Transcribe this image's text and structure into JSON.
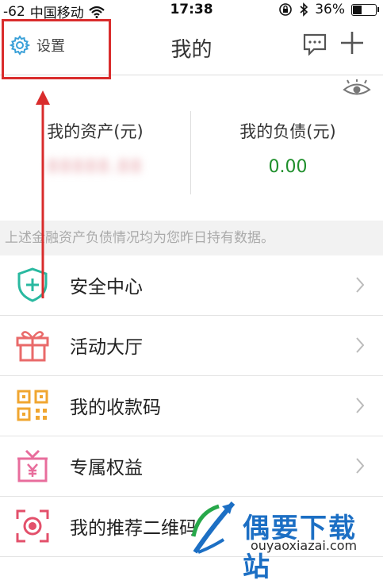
{
  "status_bar": {
    "signal": "-62",
    "carrier": "中国移动",
    "time": "17:38",
    "battery": "36%",
    "battery_level": 0.36
  },
  "nav": {
    "settings_label": "设置",
    "title": "我的"
  },
  "assets": {
    "left_label": "我的资产(元)",
    "left_value": "88888.88",
    "right_label": "我的负债(元)",
    "right_value": "0.00"
  },
  "notice": "上述金融资产负债情况均为您昨日持有数据。",
  "menu": {
    "items": [
      {
        "label": "安全中心",
        "icon": "shield-plus-icon"
      },
      {
        "label": "活动大厅",
        "icon": "gift-icon"
      },
      {
        "label": "我的收款码",
        "icon": "qr-code-icon"
      },
      {
        "label": "专属权益",
        "icon": "yen-box-icon"
      },
      {
        "label": "我的推荐二维码",
        "icon": "scan-icon"
      }
    ]
  },
  "watermark": {
    "title": "偶要下载站",
    "url": "ouyaoxiazai.com"
  },
  "colors": {
    "annotation_red": "#d92c2c",
    "green_value": "#1f8f2c",
    "watermark_blue": "#1c6fc4"
  }
}
